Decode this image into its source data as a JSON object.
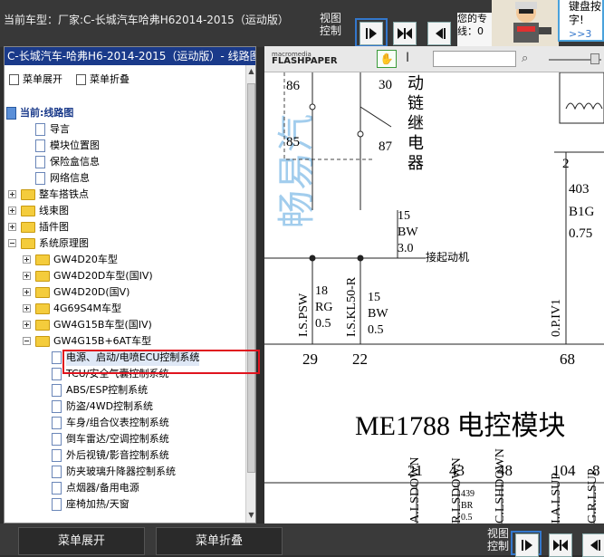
{
  "header": {
    "car_model": "当前车型：厂家:C-长城汽车哈弗H62014-2015（运动版）",
    "view_control": "视图\n控制",
    "side_note": "您的专\n线：0",
    "bubble_text": "键盘按\n字!",
    "bubble_more": ">>3"
  },
  "left_panel": {
    "title": "C-长城汽车-哈弗H6-2014-2015（运动版）- 线路图",
    "expand_menu": "菜单展开",
    "collapse_menu": "菜单折叠",
    "tree": [
      {
        "label": "当前:线路图",
        "kind": "root",
        "indent": 0
      },
      {
        "label": "导言",
        "kind": "doc",
        "indent": 1
      },
      {
        "label": "模块位置图",
        "kind": "doc",
        "indent": 1
      },
      {
        "label": "保险盒信息",
        "kind": "doc",
        "indent": 1
      },
      {
        "label": "网络信息",
        "kind": "doc",
        "indent": 1
      },
      {
        "label": "整车搭铁点",
        "kind": "folder",
        "indent": 0,
        "state": "collapsed"
      },
      {
        "label": "线束图",
        "kind": "folder",
        "indent": 0,
        "state": "collapsed"
      },
      {
        "label": "插件图",
        "kind": "folder",
        "indent": 0,
        "state": "collapsed"
      },
      {
        "label": "系统原理图",
        "kind": "folder",
        "indent": 0,
        "state": "expanded"
      },
      {
        "label": "GW4D20车型",
        "kind": "folder",
        "indent": 1,
        "state": "collapsed"
      },
      {
        "label": "GW4D20D车型(国IV)",
        "kind": "folder",
        "indent": 1,
        "state": "collapsed"
      },
      {
        "label": "GW4D20D(国V)",
        "kind": "folder",
        "indent": 1,
        "state": "collapsed"
      },
      {
        "label": "4G69S4M车型",
        "kind": "folder",
        "indent": 1,
        "state": "collapsed"
      },
      {
        "label": "GW4G15B车型(国IV)",
        "kind": "folder",
        "indent": 1,
        "state": "collapsed"
      },
      {
        "label": "GW4G15B+6AT车型",
        "kind": "folder",
        "indent": 1,
        "state": "expanded"
      },
      {
        "label": "电源、启动/电喷ECU控制系统",
        "kind": "doc",
        "indent": 2,
        "selected": true
      },
      {
        "label": "TCU/安全气囊控制系统",
        "kind": "doc",
        "indent": 2
      },
      {
        "label": "ABS/ESP控制系统",
        "kind": "doc",
        "indent": 2
      },
      {
        "label": "防盗/4WD控制系统",
        "kind": "doc",
        "indent": 2
      },
      {
        "label": "车身/组合仪表控制系统",
        "kind": "doc",
        "indent": 2
      },
      {
        "label": "倒车雷达/空调控制系统",
        "kind": "doc",
        "indent": 2
      },
      {
        "label": "外后视镜/影音控制系统",
        "kind": "doc",
        "indent": 2
      },
      {
        "label": "防夹玻璃升降器控制系统",
        "kind": "doc",
        "indent": 2
      },
      {
        "label": "点烟器/备用电源",
        "kind": "doc",
        "indent": 2
      },
      {
        "label": "座椅加热/天窗",
        "kind": "doc",
        "indent": 2
      }
    ]
  },
  "viewer": {
    "logo_line1": "macromedia",
    "logo_line2": "FLASHPAPER",
    "diagram": {
      "relay_pins": [
        "86",
        "30",
        "85",
        "87"
      ],
      "relay_label": "动\n链\n继\n电\n器",
      "wire_15_bw": "15\nBW\n3.0",
      "start_motor": "接起动机",
      "wire_403": "403",
      "wire_b1g": "B1G",
      "wire_075": "0.75",
      "pin2": "2",
      "col_labels": [
        "I.S.PSW",
        "18\nRG\n0.5",
        "I.S.KL50-R",
        "15\nBW\n0.5",
        "0.P.IV1"
      ],
      "pin_numbers_top": [
        "29",
        "22",
        "68"
      ],
      "module_title": "ME1788 电控模块",
      "pin_numbers_bottom": [
        "21",
        "43",
        "48",
        "104",
        "8"
      ],
      "bottom_labels": [
        "A.LSDOWN",
        "R.LSDOWN",
        "439\nBR\n0.5",
        "C.LSHDOWN",
        "I.A.LSUP",
        "G.R.LSUP"
      ],
      "watermark": "畅易汽"
    }
  },
  "footer": {
    "expand_button": "菜单展开",
    "collapse_button": "菜单折叠",
    "view_control": "视图\n控制"
  }
}
